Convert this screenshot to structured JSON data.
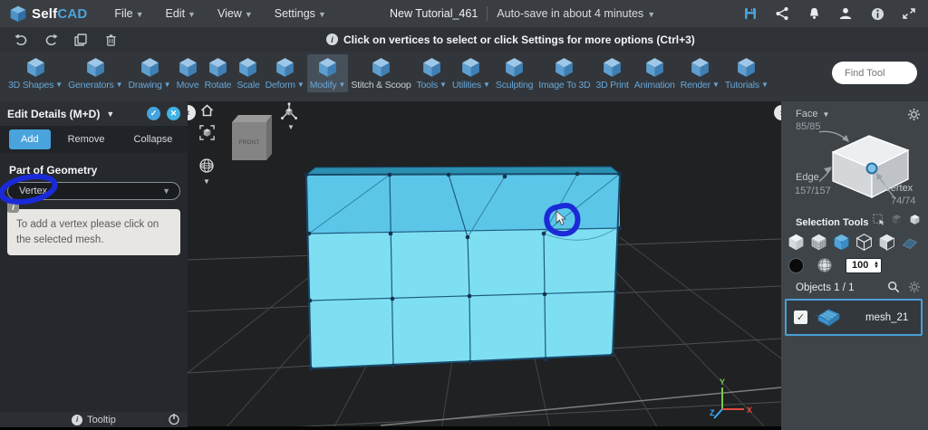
{
  "menubar": {
    "logo_self": "Self",
    "logo_cad": "CAD",
    "menus": [
      "File",
      "Edit",
      "View",
      "Settings"
    ],
    "doc_title": "New Tutorial_461",
    "autosave": "Auto-save in about 4 minutes"
  },
  "infobar": {
    "message": "Click on vertices to select or click Settings for more options (Ctrl+3)"
  },
  "toolbar": {
    "find_tool_placeholder": "Find Tool",
    "items": [
      {
        "label": "3D Shapes",
        "caret": true
      },
      {
        "label": "Generators",
        "caret": true
      },
      {
        "label": "Drawing",
        "caret": true
      },
      {
        "label": "Move",
        "caret": false
      },
      {
        "label": "Rotate",
        "caret": false
      },
      {
        "label": "Scale",
        "caret": false
      },
      {
        "label": "Deform",
        "caret": true
      },
      {
        "label": "Modify",
        "caret": true,
        "active": true
      },
      {
        "label": "Stitch & Scoop",
        "caret": false,
        "muted": true
      },
      {
        "label": "Tools",
        "caret": true
      },
      {
        "label": "Utilities",
        "caret": true
      },
      {
        "label": "Sculpting",
        "caret": false
      },
      {
        "label": "Image To 3D",
        "caret": false
      },
      {
        "label": "3D Print",
        "caret": false
      },
      {
        "label": "Animation",
        "caret": false
      },
      {
        "label": "Render",
        "caret": true
      },
      {
        "label": "Tutorials",
        "caret": true
      }
    ]
  },
  "left_panel": {
    "title": "Edit Details (M+D)",
    "tabs": [
      "Add",
      "Remove",
      "Collapse"
    ],
    "active_tab": "Add",
    "section_label": "Part of Geometry",
    "dropdown_value": "Vertex",
    "tooltip_text": "To add a vertex please click on the selected mesh.",
    "footer_label": "Tooltip"
  },
  "viewport": {
    "nav_cube_label": "FRONT",
    "axis_x": "X",
    "axis_y": "Y",
    "axis_z": "Z"
  },
  "right_panel": {
    "face_label": "Face",
    "face_count": "85/85",
    "edge_label": "Edge",
    "edge_count": "157/157",
    "vertex_label": "Vertex",
    "vertex_count": "74/74",
    "selection_tools_label": "Selection Tools",
    "brush_size": "100",
    "objects_label": "Objects 1 / 1",
    "object_name": "mesh_21"
  },
  "colors": {
    "accent": "#4da3dc",
    "mesh_light": "#7edff2",
    "mesh_dark": "#5cc6e9",
    "annotation_blue": "#1b2ad8"
  }
}
